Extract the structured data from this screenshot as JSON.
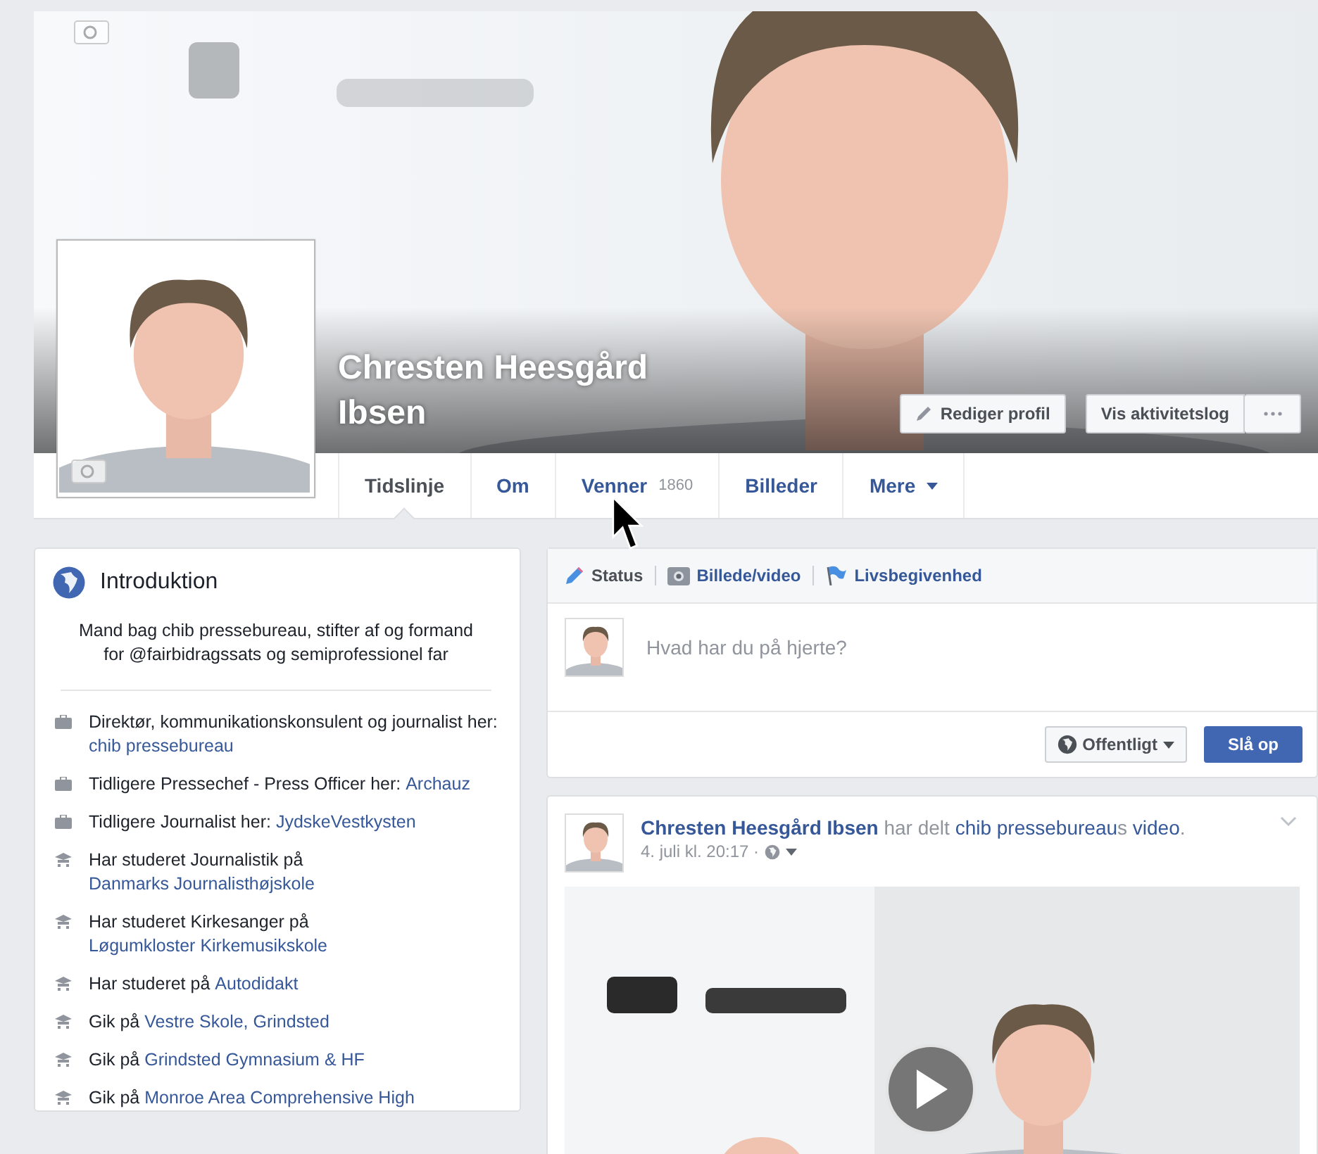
{
  "profile": {
    "name": "Chresten Heesgård Ibsen",
    "edit_button": "Rediger profil",
    "activity_button": "Vis aktivitetslog"
  },
  "tabs": [
    {
      "label": "Tidslinje",
      "selected": true
    },
    {
      "label": "Om",
      "selected": false
    },
    {
      "label": "Venner",
      "count": "1860",
      "selected": false
    },
    {
      "label": "Billeder",
      "selected": false
    },
    {
      "label": "Mere",
      "dropdown": true,
      "selected": false
    }
  ],
  "intro": {
    "title": "Introduktion",
    "bio": "Mand bag chib pressebureau, stifter af og formand for @fairbidragssats og semiprofessionel far",
    "items": [
      {
        "kind": "work",
        "text": "Direktør, kommunikationskonsulent og journalist her:",
        "link": "chib pressebureau"
      },
      {
        "kind": "work",
        "text": "Tidligere Pressechef - Press Officer her:",
        "link": "Archauz"
      },
      {
        "kind": "work",
        "text": "Tidligere Journalist her:",
        "link": "JydskeVestkysten"
      },
      {
        "kind": "education",
        "text": "Har studeret Journalistik på",
        "link": "Danmarks Journalisthøjskole"
      },
      {
        "kind": "education",
        "text": "Har studeret Kirkesanger på",
        "link": "Løgumkloster Kirkemusikskole"
      },
      {
        "kind": "education",
        "text": "Har studeret på",
        "link": "Autodidakt"
      },
      {
        "kind": "education",
        "text": "Gik på",
        "link": "Vestre Skole, Grindsted"
      },
      {
        "kind": "education",
        "text": "Gik på",
        "link": "Grindsted Gymnasium & HF"
      },
      {
        "kind": "education",
        "text": "Gik på",
        "link": "Monroe Area Comprehensive High"
      }
    ]
  },
  "composer": {
    "tabs": [
      {
        "kind": "status",
        "label": "Status",
        "selected": true
      },
      {
        "label": "Billede/video",
        "selected": false
      },
      {
        "kind": "event",
        "label": "Livsbegivenhed",
        "selected": false
      }
    ],
    "placeholder": "Hvad har du på hjerte?",
    "audience": "Offentligt",
    "post_button": "Slå op"
  },
  "post": {
    "header": [
      {
        "kind": "name",
        "text": "Chresten Heesgård Ibsen"
      },
      {
        "kind": "plain",
        "text": " har delt "
      },
      {
        "kind": "link",
        "text": "chib pressebureau"
      },
      {
        "kind": "plain",
        "text": "s "
      },
      {
        "kind": "link",
        "text": "video"
      },
      {
        "kind": "plain",
        "text": "."
      }
    ],
    "time": "4. juli kl. 20:17 ·"
  }
}
